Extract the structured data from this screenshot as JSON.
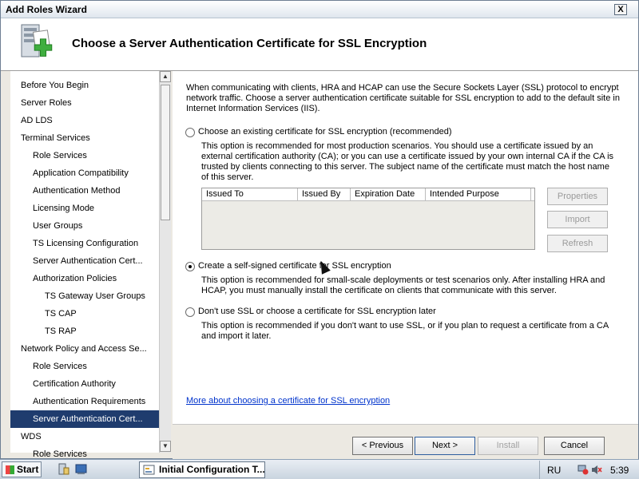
{
  "window": {
    "title": "Add Roles Wizard",
    "close_glyph": "X",
    "heading": "Choose a Server Authentication Certificate for SSL Encryption",
    "icon": "server-add-role-icon"
  },
  "sidebar": {
    "items": [
      {
        "label": "Before You Begin",
        "level": 0
      },
      {
        "label": "Server Roles",
        "level": 0
      },
      {
        "label": "AD LDS",
        "level": 0
      },
      {
        "label": "Terminal Services",
        "level": 0
      },
      {
        "label": "Role Services",
        "level": 1
      },
      {
        "label": "Application Compatibility",
        "level": 1
      },
      {
        "label": "Authentication Method",
        "level": 1
      },
      {
        "label": "Licensing Mode",
        "level": 1
      },
      {
        "label": "User Groups",
        "level": 1
      },
      {
        "label": "TS Licensing Configuration",
        "level": 1
      },
      {
        "label": "Server Authentication Cert...",
        "level": 1
      },
      {
        "label": "Authorization Policies",
        "level": 1
      },
      {
        "label": "TS Gateway User Groups",
        "level": 2
      },
      {
        "label": "TS CAP",
        "level": 2
      },
      {
        "label": "TS RAP",
        "level": 2
      },
      {
        "label": "Network Policy and Access Se...",
        "level": 0
      },
      {
        "label": "Role Services",
        "level": 1
      },
      {
        "label": "Certification Authority",
        "level": 1
      },
      {
        "label": "Authentication Requirements",
        "level": 1
      },
      {
        "label": "Server Authentication Cert...",
        "level": 1,
        "selected": true
      },
      {
        "label": "WDS",
        "level": 0
      },
      {
        "label": "Role Services",
        "level": 1
      }
    ],
    "scroll_up_glyph": "▲",
    "scroll_down_glyph": "▼"
  },
  "main": {
    "intro": "When communicating with clients, HRA and HCAP can use the Secure Sockets Layer (SSL) protocol to encrypt network traffic. Choose a server authentication certificate suitable for SSL encryption to add to the default site in Internet Information Services (IIS).",
    "option_existing": {
      "label": "Choose an existing certificate for SSL encryption (recommended)",
      "desc": "This option is recommended for most production scenarios. You should use a certificate issued by an external certification authority (CA); or you can use a certificate issued by your own internal CA if the CA is trusted by clients connecting to this server. The subject name of the certificate must match the host name of this server.",
      "selected": false
    },
    "cert_table": {
      "columns": [
        "Issued To",
        "Issued By",
        "Expiration Date",
        "Intended Purpose"
      ]
    },
    "buttons": {
      "properties": "Properties",
      "import": "Import",
      "refresh": "Refresh"
    },
    "option_selfsigned": {
      "label": "Create a self-signed certificate for SSL encryption",
      "desc": "This option is recommended for small-scale deployments or test scenarios only. After installing HRA and HCAP, you must manually install the certificate on clients that communicate with this server.",
      "selected": true
    },
    "option_nossl": {
      "label": "Don't use SSL or choose a certificate for SSL encryption later",
      "desc": "This option is recommended if you don't want to use SSL, or if you plan to request a certificate from a CA and import it later.",
      "selected": false
    },
    "link": "More about choosing a certificate for SSL encryption"
  },
  "footer": {
    "previous": "< Previous",
    "next": "Next >",
    "install": "Install",
    "cancel": "Cancel"
  },
  "taskbar": {
    "start": "Start",
    "task": "Initial Configuration T...",
    "language": "RU",
    "clock": "5:39"
  }
}
